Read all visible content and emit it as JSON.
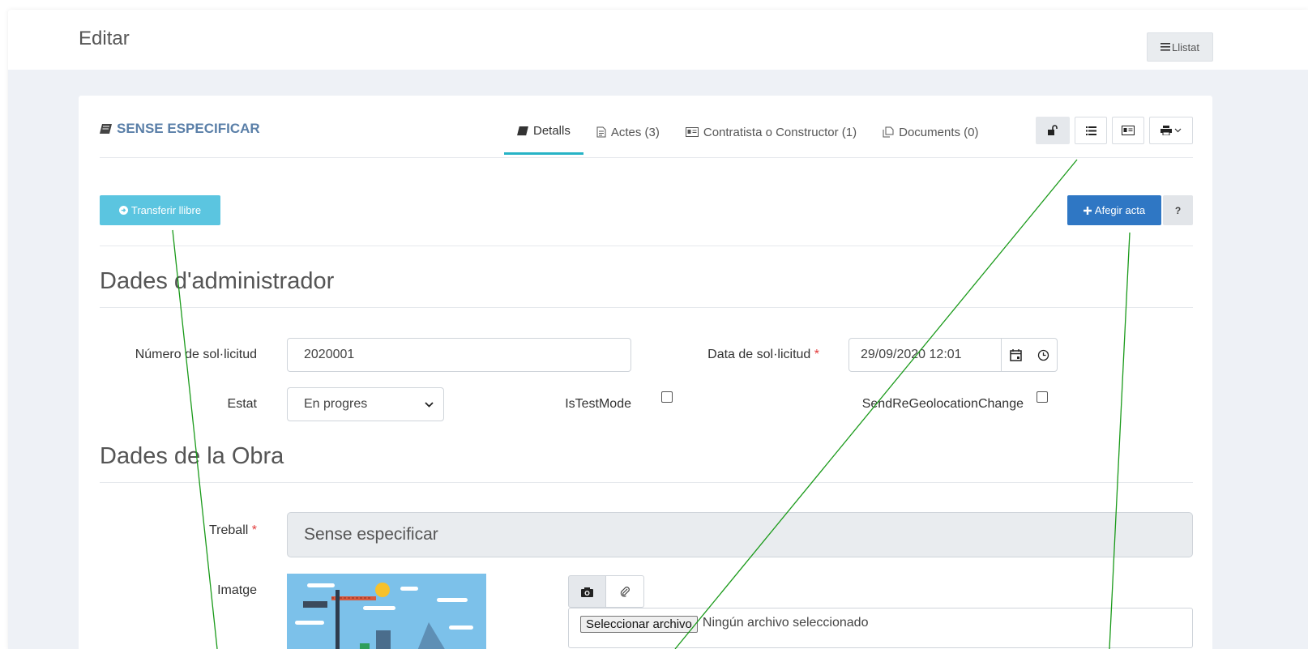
{
  "header": {
    "title": "Editar",
    "llistat_label": "Llistat"
  },
  "card": {
    "title": "SENSE ESPECIFICAR",
    "tabs": [
      {
        "label": "Detalls",
        "active": true
      },
      {
        "label": "Actes (3)",
        "active": false
      },
      {
        "label": "Contratista o Constructor (1)",
        "active": false
      },
      {
        "label": "Documents (0)",
        "active": false
      }
    ]
  },
  "actions": {
    "transferir_label": "Transferir llibre",
    "afegir_label": "Afegir acta",
    "help_label": "?"
  },
  "admin": {
    "section_title": "Dades d'administrador",
    "numero_label": "Número de sol·licitud",
    "numero_value": "2020001",
    "data_label": "Data de sol·licitud",
    "data_value": "29/09/2020 12:01",
    "required_mark": "*",
    "estat_label": "Estat",
    "estat_value": "En progres",
    "istest_label": "IsTestMode",
    "sendre_label": "SendReGeolocationChange"
  },
  "obra": {
    "section_title": "Dades de la Obra",
    "treball_label": "Treball",
    "treball_value": "Sense especificar",
    "imatge_label": "Imatge",
    "file_button_label": "Seleccionar archivo",
    "file_status": "Ningún archivo seleccionado"
  },
  "colors": {
    "accent_tab": "#26b3c6",
    "primary": "#2f77c4",
    "info": "#5bc5e0",
    "annotation_arrow": "#1a9a1a"
  }
}
